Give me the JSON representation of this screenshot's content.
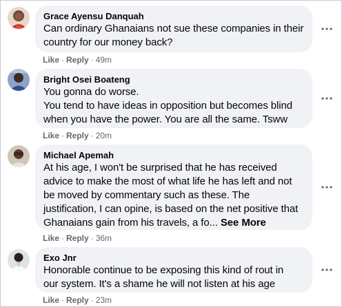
{
  "comments": [
    {
      "author": "Grace Ayensu Danquah",
      "text": "Can ordinary Ghanaians not sue these companies in their\ncountry for our money back?",
      "see_more": "",
      "like": "Like",
      "reply": "Reply",
      "time": "49m",
      "avatar_icon": "profile-photo-woman-red",
      "more_icon": "more-options-icon"
    },
    {
      "author": "Bright Osei Boateng",
      "text": "You gonna do worse.\nYou tend to have ideas in opposition but becomes blind\nwhen you have the power. You are all the same. Tsww",
      "see_more": "",
      "like": "Like",
      "reply": "Reply",
      "time": "20m",
      "avatar_icon": "profile-photo-man-blue",
      "more_icon": "more-options-icon"
    },
    {
      "author": "Michael Apemah",
      "text": "At his age, I won't be surprised that he has received\nadvice to make the most of what life he has left and not\nbe moved by commentary such as these. The\njustification, I can opine, is based on the net positive that\nGhanaians gain from his travels, a fo...",
      "see_more": "See More",
      "like": "Like",
      "reply": "Reply",
      "time": "36m",
      "avatar_icon": "profile-photo-man-glasses",
      "more_icon": "more-options-icon"
    },
    {
      "author": "Exo Jnr",
      "text": "Honorable continue to be exposing this kind of rout in\nour system. It's a shame he will not listen at his age",
      "see_more": "",
      "like": "Like",
      "reply": "Reply",
      "time": "23m",
      "avatar_icon": "profile-photo-man-white-shirt",
      "more_icon": "more-options-icon"
    }
  ],
  "colors": {
    "bubble": "#f0f2f5",
    "text": "#050505",
    "secondary": "#65676b",
    "border": "#c9ccd1"
  }
}
